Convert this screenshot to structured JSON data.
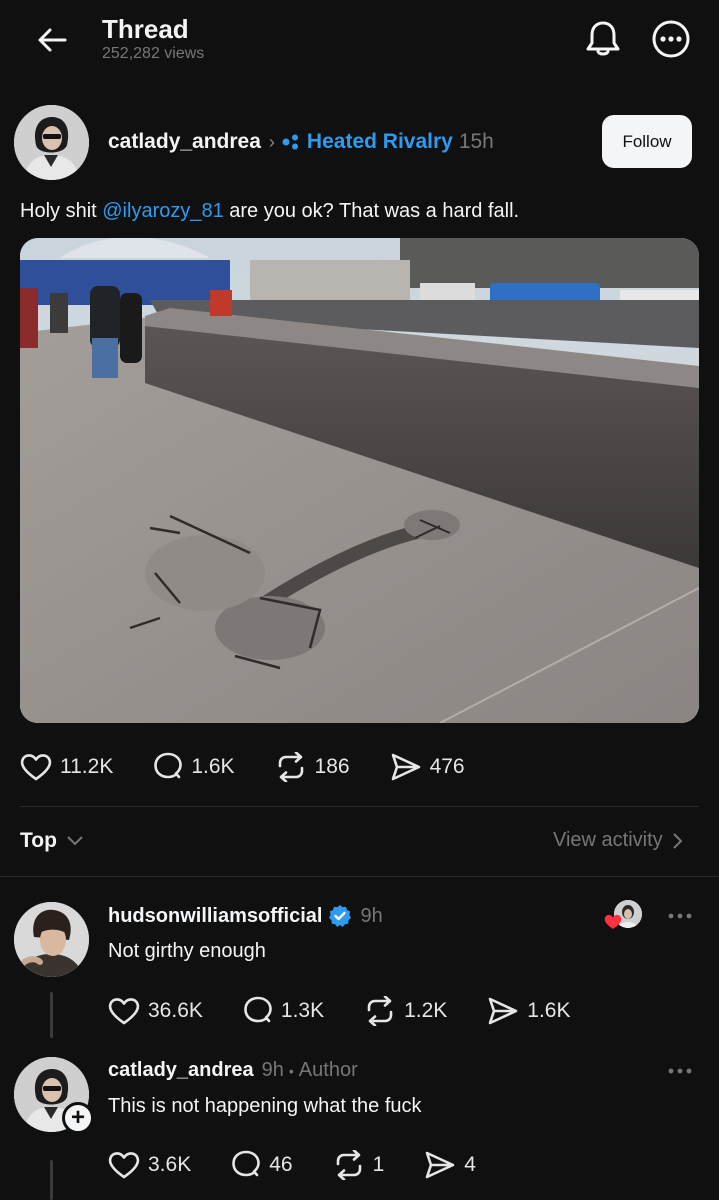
{
  "header": {
    "title": "Thread",
    "views": "252,282 views"
  },
  "post": {
    "username": "catlady_andrea",
    "community": "Heated Rivalry",
    "time": "15h",
    "follow_label": "Follow",
    "text_before": "Holy shit ",
    "mention": "@ilyarozy_81",
    "text_after": " are you ok? That was a hard fall.",
    "stats": {
      "likes": "11.2K",
      "comments": "1.6K",
      "reposts": "186",
      "shares": "476"
    }
  },
  "replies_bar": {
    "sort_label": "Top",
    "activity_label": "View activity"
  },
  "replies": [
    {
      "username": "hudsonwilliamsofficial",
      "verified": true,
      "time": "9h",
      "text": "Not girthy enough",
      "stats": {
        "likes": "36.6K",
        "comments": "1.3K",
        "reposts": "1.2K",
        "shares": "1.6K"
      }
    },
    {
      "username": "catlady_andrea",
      "time": "9h",
      "separator": "•",
      "author_tag": "Author",
      "text": "This is not happening what the fuck",
      "stats": {
        "likes": "3.6K",
        "comments": "46",
        "reposts": "1",
        "shares": "4"
      }
    }
  ],
  "colors": {
    "background": "#101010",
    "link": "#2d9cf0",
    "muted": "#777777",
    "like_red": "#ff3040"
  }
}
